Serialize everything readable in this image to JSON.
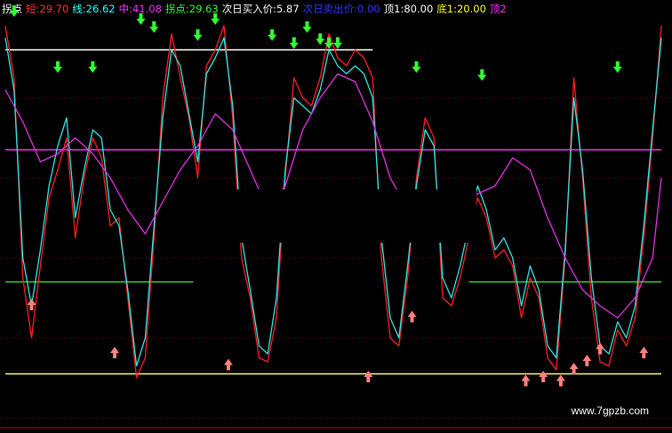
{
  "header": {
    "items": [
      {
        "text": "拐点",
        "color": "#ffffff"
      },
      {
        "text": "短:29.70",
        "color": "#ff3333"
      },
      {
        "text": "线:26.62",
        "color": "#33ffff"
      },
      {
        "text": "中:41.08",
        "color": "#ff33ff"
      },
      {
        "text": "拐点:29.63",
        "color": "#33ff33"
      },
      {
        "text": "次日买入价:5.87",
        "color": "#ffffff"
      },
      {
        "text": "次日卖出价:0.00",
        "color": "#3333ff"
      },
      {
        "text": "顶1:80.00",
        "color": "#ffffff"
      },
      {
        "text": "底1:20.00",
        "color": "#ffff33"
      },
      {
        "text": "顶2",
        "color": "#ff33ff"
      }
    ]
  },
  "watermark": "www.7gpzb.com",
  "chart_data": {
    "type": "line",
    "ylim": [
      0,
      100
    ],
    "grid": true,
    "reference_lines": [
      {
        "value": 92,
        "color": "#ffffff",
        "x_from": 0,
        "x_to": 84
      },
      {
        "value": 67,
        "color": "#ff33ff",
        "x_from": 0,
        "x_to": 150
      },
      {
        "value": 34,
        "color": "#33cc33",
        "x_from": 0,
        "x_to": 43
      },
      {
        "value": 34,
        "color": "#33cc33",
        "x_from": 106,
        "x_to": 150
      },
      {
        "value": 11,
        "color": "#ffff66",
        "x_from": 0,
        "x_to": 150
      }
    ],
    "series": [
      {
        "color": "#ff2020",
        "x": [
          0,
          2,
          4,
          6,
          8,
          10,
          12,
          14,
          16,
          18,
          20,
          22,
          24,
          26,
          28,
          30,
          32,
          34,
          36,
          38,
          40,
          42,
          44,
          46,
          48,
          50,
          52,
          54,
          56,
          58,
          60,
          62,
          64,
          66,
          68,
          70,
          72,
          74,
          76,
          78,
          80,
          82,
          84,
          86,
          88,
          90,
          92,
          94,
          96,
          98,
          100,
          102,
          104,
          106,
          108,
          110,
          112,
          114,
          116,
          118,
          120,
          122,
          124,
          126,
          128,
          130,
          132,
          134,
          136,
          138,
          140,
          142,
          144,
          146,
          148,
          150
        ],
        "values": [
          98,
          85,
          35,
          20,
          38,
          55,
          62,
          70,
          45,
          60,
          70,
          65,
          48,
          50,
          30,
          10,
          15,
          45,
          80,
          96,
          85,
          75,
          60,
          88,
          92,
          98,
          75,
          40,
          30,
          15,
          14,
          25,
          60,
          85,
          80,
          78,
          85,
          96,
          90,
          88,
          92,
          90,
          85,
          40,
          20,
          18,
          35,
          60,
          75,
          70,
          30,
          28,
          35,
          45,
          55,
          50,
          40,
          42,
          38,
          25,
          35,
          30,
          15,
          12,
          40,
          85,
          60,
          30,
          14,
          13,
          22,
          18,
          25,
          45,
          70,
          98
        ]
      },
      {
        "color": "#33e6e6",
        "x": [
          0,
          2,
          4,
          6,
          8,
          10,
          12,
          14,
          16,
          18,
          20,
          22,
          24,
          26,
          28,
          30,
          32,
          34,
          36,
          38,
          40,
          42,
          44,
          46,
          48,
          50,
          52,
          54,
          56,
          58,
          60,
          62,
          64,
          66,
          68,
          70,
          72,
          74,
          76,
          78,
          80,
          82,
          84,
          86,
          88,
          90,
          92,
          94,
          96,
          98,
          100,
          102,
          104,
          106,
          108,
          110,
          112,
          114,
          116,
          118,
          120,
          122,
          124,
          126,
          128,
          130,
          132,
          134,
          136,
          138,
          140,
          142,
          144,
          146,
          148,
          150
        ],
        "values": [
          95,
          82,
          40,
          28,
          42,
          58,
          68,
          75,
          50,
          62,
          72,
          70,
          52,
          48,
          32,
          13,
          20,
          48,
          75,
          92,
          88,
          76,
          64,
          86,
          90,
          95,
          78,
          45,
          32,
          18,
          16,
          30,
          62,
          80,
          78,
          76,
          82,
          92,
          88,
          86,
          88,
          86,
          80,
          45,
          25,
          20,
          38,
          58,
          72,
          68,
          35,
          30,
          38,
          48,
          58,
          52,
          42,
          45,
          40,
          28,
          38,
          32,
          18,
          15,
          42,
          80,
          62,
          35,
          18,
          16,
          24,
          20,
          28,
          48,
          72,
          95
        ]
      },
      {
        "color": "#e633e6",
        "x": [
          0,
          4,
          8,
          12,
          16,
          20,
          24,
          28,
          32,
          36,
          40,
          44,
          48,
          52,
          56,
          60,
          64,
          68,
          72,
          76,
          80,
          84,
          88,
          92,
          96,
          100,
          104,
          108,
          112,
          116,
          120,
          124,
          128,
          132,
          136,
          140,
          144,
          148,
          150
        ],
        "values": [
          82,
          74,
          64,
          66,
          70,
          66,
          60,
          52,
          46,
          54,
          62,
          68,
          76,
          72,
          62,
          52,
          58,
          72,
          80,
          86,
          84,
          74,
          60,
          52,
          50,
          45,
          52,
          56,
          58,
          65,
          62,
          50,
          40,
          32,
          28,
          25,
          30,
          40,
          60
        ]
      }
    ],
    "markers": [
      {
        "type": "down-arrow",
        "color": "#33ff33",
        "x": [
          2,
          12,
          20,
          31,
          34,
          44,
          48,
          61,
          66,
          69,
          72,
          74,
          76,
          94,
          109,
          140
        ],
        "y": [
          100,
          86,
          86,
          98,
          96,
          94,
          98,
          94,
          92,
          96,
          93,
          92,
          92,
          86,
          84,
          86
        ]
      },
      {
        "type": "up-arrow",
        "color": "#ff8080",
        "x": [
          6,
          25,
          51,
          83,
          93,
          119,
          123,
          127,
          130,
          133,
          136,
          146
        ],
        "y": [
          30,
          18,
          15,
          12,
          27,
          11,
          12,
          11,
          14,
          16,
          19,
          18
        ]
      }
    ]
  }
}
